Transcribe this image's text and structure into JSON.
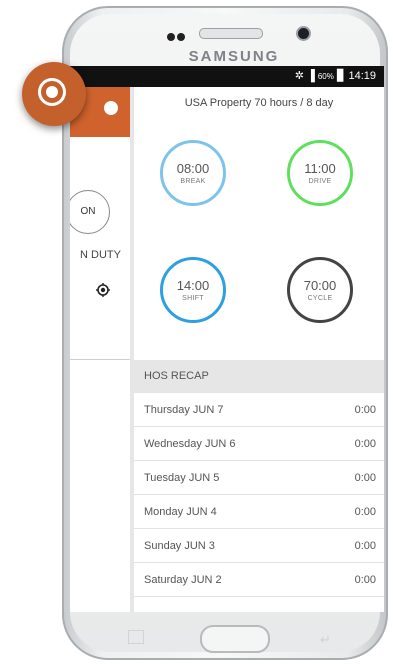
{
  "device": {
    "brand": "SAMSUNG"
  },
  "status_bar": {
    "battery": "60%",
    "time": "14:19"
  },
  "sidebar": {
    "status_button": "ON",
    "status_label": "N DUTY"
  },
  "main": {
    "ruleset": "USA Property 70 hours / 8 day",
    "gauges": [
      {
        "time": "08:00",
        "label": "BREAK",
        "color": "#7fc3ea"
      },
      {
        "time": "11:00",
        "label": "DRIVE",
        "color": "#5fe05c"
      },
      {
        "time": "14:00",
        "label": "SHIFT",
        "color": "#2e9fe0"
      },
      {
        "time": "70:00",
        "label": "CYCLE",
        "color": "#444444"
      }
    ],
    "recap": {
      "title": "HOS RECAP",
      "rows": [
        {
          "day": "Thursday JUN 7",
          "hours": "0:00"
        },
        {
          "day": "Wednesday JUN 6",
          "hours": "0:00"
        },
        {
          "day": "Tuesday JUN 5",
          "hours": "0:00"
        },
        {
          "day": "Monday JUN 4",
          "hours": "0:00"
        },
        {
          "day": "Sunday JUN 3",
          "hours": "0:00"
        },
        {
          "day": "Saturday JUN 2",
          "hours": "0:00"
        }
      ]
    }
  },
  "colors": {
    "accent": "#c4602c",
    "header": "#d0632d"
  }
}
